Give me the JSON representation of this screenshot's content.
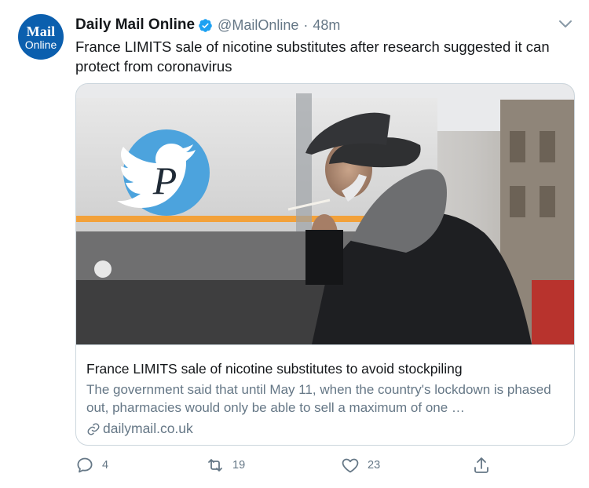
{
  "author": {
    "name": "Daily Mail Online",
    "handle": "@MailOnline",
    "separator": "·",
    "time": "48m",
    "avatar_line1": "Mail",
    "avatar_line2": "Online"
  },
  "tweet": {
    "text": "France LIMITS sale of nicotine substitutes after research suggested it can protect from coronavirus"
  },
  "card": {
    "title": "France LIMITS sale of nicotine substitutes to avoid stockpiling",
    "description": "The government said that until May 11, when the country's lockdown is phased out, pharmacies would only be able to sell a maximum of one …",
    "domain": "dailymail.co.uk",
    "image_overlay_letter": "P"
  },
  "actions": {
    "reply_count": "4",
    "retweet_count": "19",
    "like_count": "23"
  },
  "icons": [
    "verified-icon",
    "chevron-down-icon",
    "link-icon",
    "reply-icon",
    "retweet-icon",
    "like-icon",
    "share-icon"
  ],
  "colors": {
    "brand_blue": "#1da1f2",
    "avatar_blue": "#0b5fae",
    "muted_text": "#657786",
    "border": "#ccd6dd"
  }
}
